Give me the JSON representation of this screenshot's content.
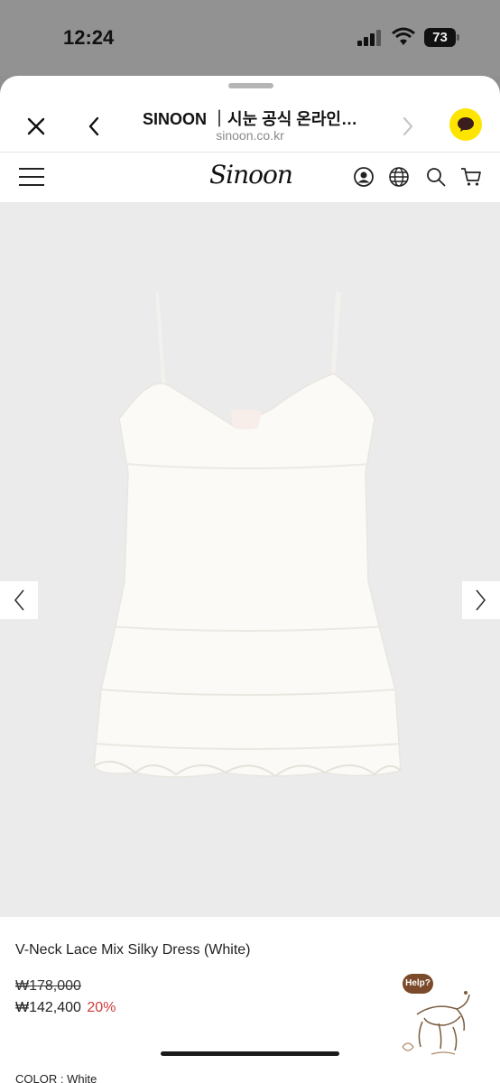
{
  "status_bar": {
    "time": "12:24",
    "battery": "73"
  },
  "browser": {
    "title": "SINOON ｜시눈 공식 온라인…",
    "url": "sinoon.co.kr"
  },
  "site": {
    "logo": "Sinoon"
  },
  "product": {
    "name": "V-Neck Lace Mix Silky Dress (White)",
    "original_price": "₩178,000",
    "sale_price": "₩142,400",
    "discount": "20%",
    "color_label": "COLOR : White"
  },
  "help_widget": {
    "label": "Help?"
  },
  "colors": {
    "kakao": "#fee500",
    "discount": "#d33a3a",
    "image_bg": "#ebebeb"
  }
}
